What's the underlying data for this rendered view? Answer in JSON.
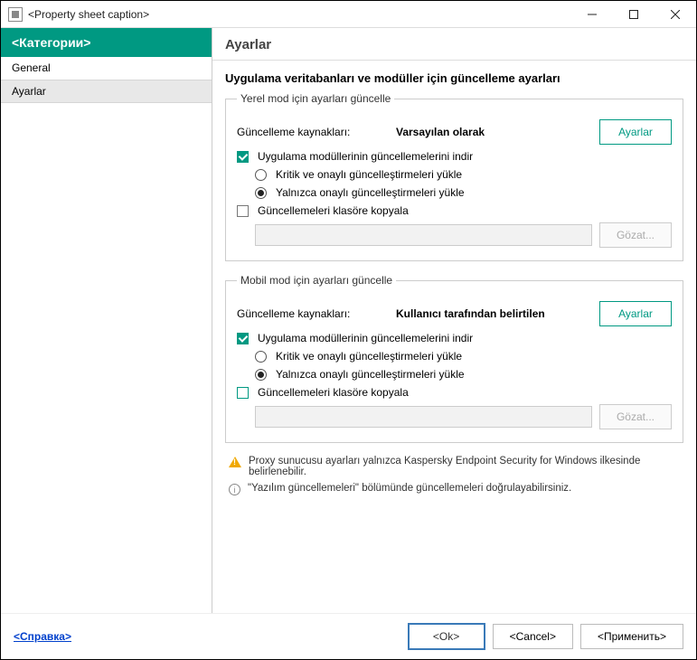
{
  "window": {
    "title": "<Property sheet caption>"
  },
  "sidebar": {
    "header": "<Категории>",
    "items": [
      {
        "label": "General",
        "selected": false
      },
      {
        "label": "Ayarlar",
        "selected": true
      }
    ]
  },
  "main": {
    "header": "Ayarlar",
    "section_title": "Uygulama veritabanları ve modüller için güncelleme ayarları",
    "groups": {
      "local": {
        "legend": "Yerel mod için ayarları güncelle",
        "sources_label": "Güncelleme kaynakları:",
        "sources_value": "Varsayılan olarak",
        "settings_btn": "Ayarlar",
        "download_updates": "Uygulama modüllerinin güncellemelerini indir",
        "radio_critical": "Kritik ve onaylı güncelleştirmeleri yükle",
        "radio_approved": "Yalnızca onaylı güncelleştirmeleri yükle",
        "copy_to_folder": "Güncellemeleri klasöre kopyala",
        "browse_btn": "Gözat..."
      },
      "mobile": {
        "legend": "Mobil mod için ayarları güncelle",
        "sources_label": "Güncelleme kaynakları:",
        "sources_value": "Kullanıcı tarafından belirtilen",
        "settings_btn": "Ayarlar",
        "download_updates": "Uygulama modüllerinin güncellemelerini indir",
        "radio_critical": "Kritik ve onaylı güncelleştirmeleri yükle",
        "radio_approved": "Yalnızca onaylı güncelleştirmeleri yükle",
        "copy_to_folder": "Güncellemeleri klasöre kopyala",
        "browse_btn": "Gözat..."
      }
    },
    "notes": {
      "warn": "Proxy sunucusu ayarları yalnızca Kaspersky Endpoint Security for Windows ilkesinde belirlenebilir.",
      "info": "\"Yazılım güncellemeleri\" bölümünde güncellemeleri doğrulayabilirsiniz."
    }
  },
  "footer": {
    "help_link": "<Справка>",
    "ok": "<Ok>",
    "cancel": "<Cancel>",
    "apply": "<Применить>"
  }
}
